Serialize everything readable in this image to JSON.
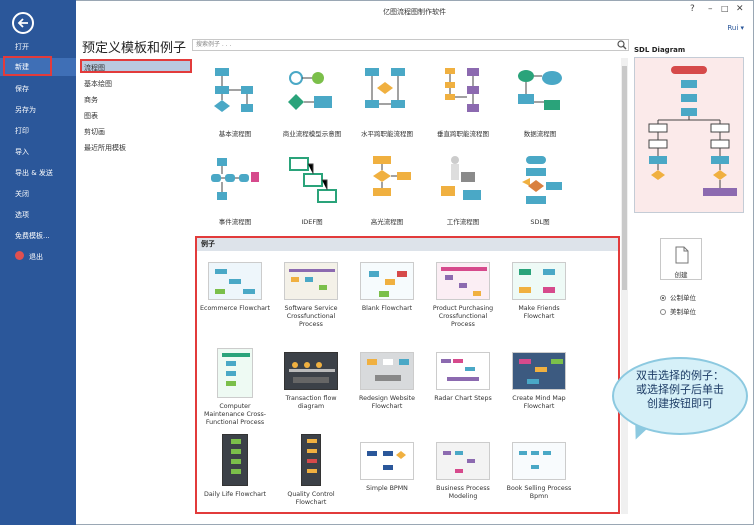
{
  "app": {
    "title": "亿图流程图制作软件",
    "user": "Rui ▾"
  },
  "nav": {
    "items": [
      {
        "label": "打开"
      },
      {
        "label": "新建"
      },
      {
        "label": "保存"
      },
      {
        "label": "另存为"
      },
      {
        "label": "打印"
      },
      {
        "label": "导入"
      },
      {
        "label": "导出 & 发送"
      },
      {
        "label": "关闭"
      },
      {
        "label": "选项"
      },
      {
        "label": "免费模板..."
      },
      {
        "label": "退出"
      }
    ]
  },
  "main": {
    "heading": "预定义模板和例子",
    "search_placeholder": "搜索例子 . . ."
  },
  "categories": [
    {
      "label": "流程图"
    },
    {
      "label": "基本绘图"
    },
    {
      "label": "商务"
    },
    {
      "label": "图表"
    },
    {
      "label": "剪切画"
    },
    {
      "label": "最近所用模板"
    }
  ],
  "templates": [
    {
      "label": "基本流程图"
    },
    {
      "label": "商业流程模型示意图"
    },
    {
      "label": "水平跨职能流程图"
    },
    {
      "label": "垂直跨职能流程图"
    },
    {
      "label": "数据流程图"
    },
    {
      "label": "事件流程图"
    },
    {
      "label": "IDEF图"
    },
    {
      "label": "高光流程图"
    },
    {
      "label": "工作流程图"
    },
    {
      "label": "SDL图"
    }
  ],
  "examples": {
    "header": "例子",
    "items": [
      {
        "label": "Ecommerce Flowchart"
      },
      {
        "label": "Software Service Crossfunctional Process"
      },
      {
        "label": "Blank Flowchart"
      },
      {
        "label": "Product Purchasing Crossfunctional Process"
      },
      {
        "label": "Make Friends Flowchart"
      },
      {
        "label": "Computer Maintenance Cross-Functional Process"
      },
      {
        "label": "Transaction flow diagram"
      },
      {
        "label": "Redesign Website Flowchart"
      },
      {
        "label": "Radar Chart Steps"
      },
      {
        "label": "Create Mind Map Flowchart"
      },
      {
        "label": "Daily Life Flowchart"
      },
      {
        "label": "Quality Control Flowchart"
      },
      {
        "label": "Simple BPMN"
      },
      {
        "label": "Business Process Modeling"
      },
      {
        "label": "Book Selling Process Bpmn"
      }
    ]
  },
  "right_panel": {
    "title": "SDL Diagram",
    "create_label": "创建",
    "units": [
      {
        "label": "公制单位",
        "selected": true
      },
      {
        "label": "美制单位",
        "selected": false
      }
    ]
  },
  "callout": {
    "line1": "双击选择的例子：",
    "line2": "或选择例子后单击",
    "line3": "创建按钮即可"
  },
  "colors": {
    "nav_bg": "#2b579a",
    "highlight": "#e23b3b",
    "accent": "#4aa8c6"
  }
}
